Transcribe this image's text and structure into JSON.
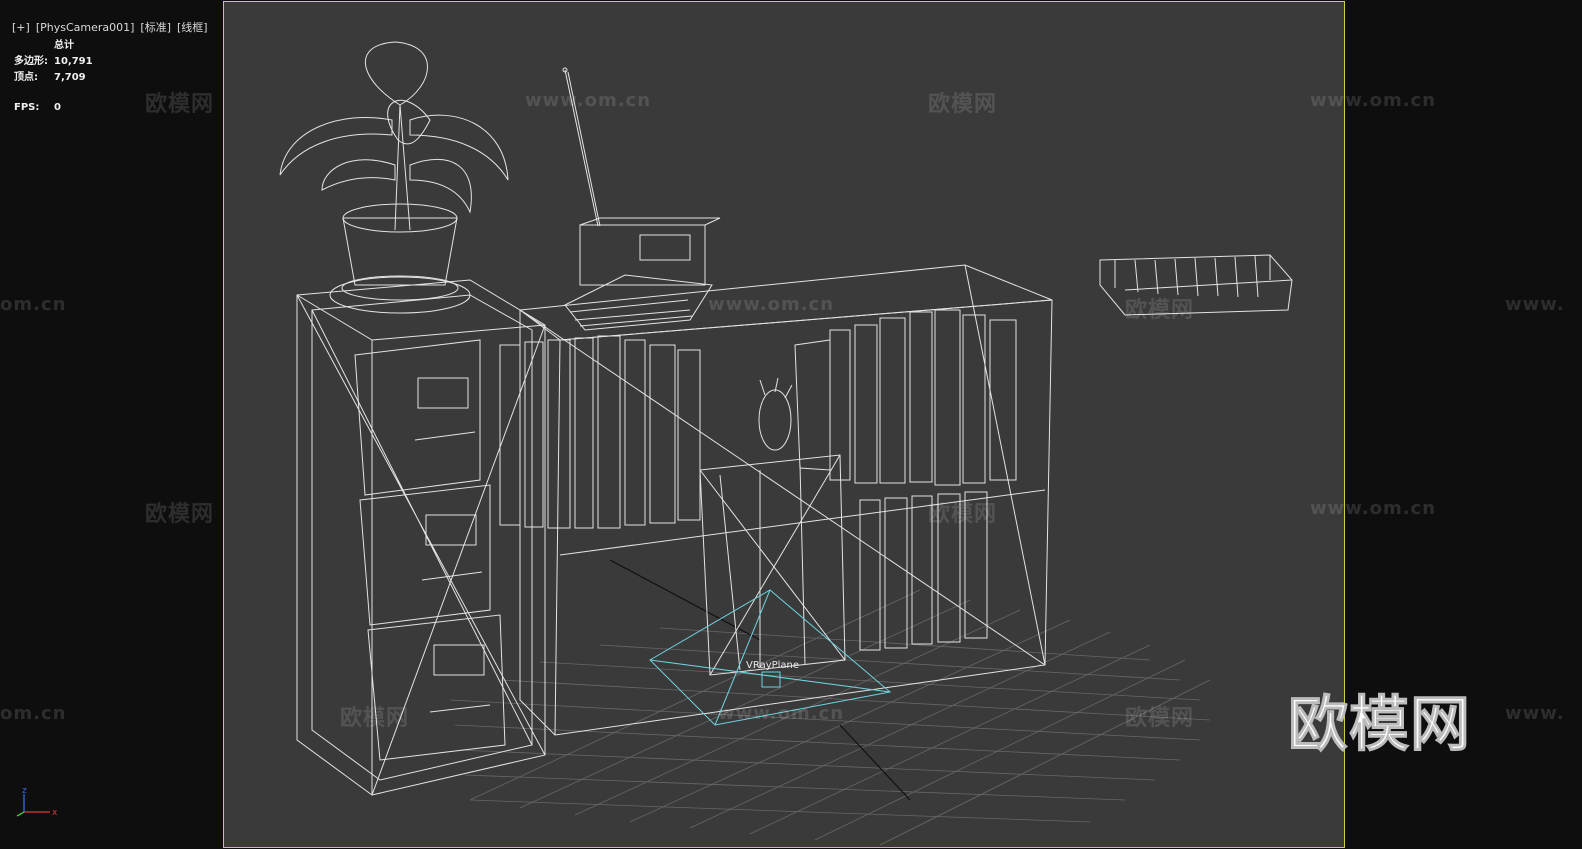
{
  "viewport": {
    "label_plus": "[+]",
    "label_camera": "[PhysCamera001]",
    "label_shading": "[标准]",
    "label_mode": "[线框]"
  },
  "stats": {
    "header": "总计",
    "polys_label": "多边形:",
    "polys_value": "10,791",
    "verts_label": "顶点:",
    "verts_value": "7,709",
    "fps_label": "FPS:",
    "fps_value": "0"
  },
  "scene": {
    "vray_plane_label": "VRayPlane"
  },
  "watermarks": {
    "cn": "欧模网",
    "url": "www.om.cn",
    "url_partial_left": "om.cn",
    "url_partial_right": "www."
  },
  "brand_logo": "欧模网",
  "axis": {
    "x": "x",
    "z": "z"
  },
  "colors": {
    "viewport_bg": "#3a3a3a",
    "frame_border": "#cfcf3c",
    "wireframe": "#f2f2f2",
    "grid": "#6a6a6a",
    "vray_plane": "#6fd3e0"
  }
}
